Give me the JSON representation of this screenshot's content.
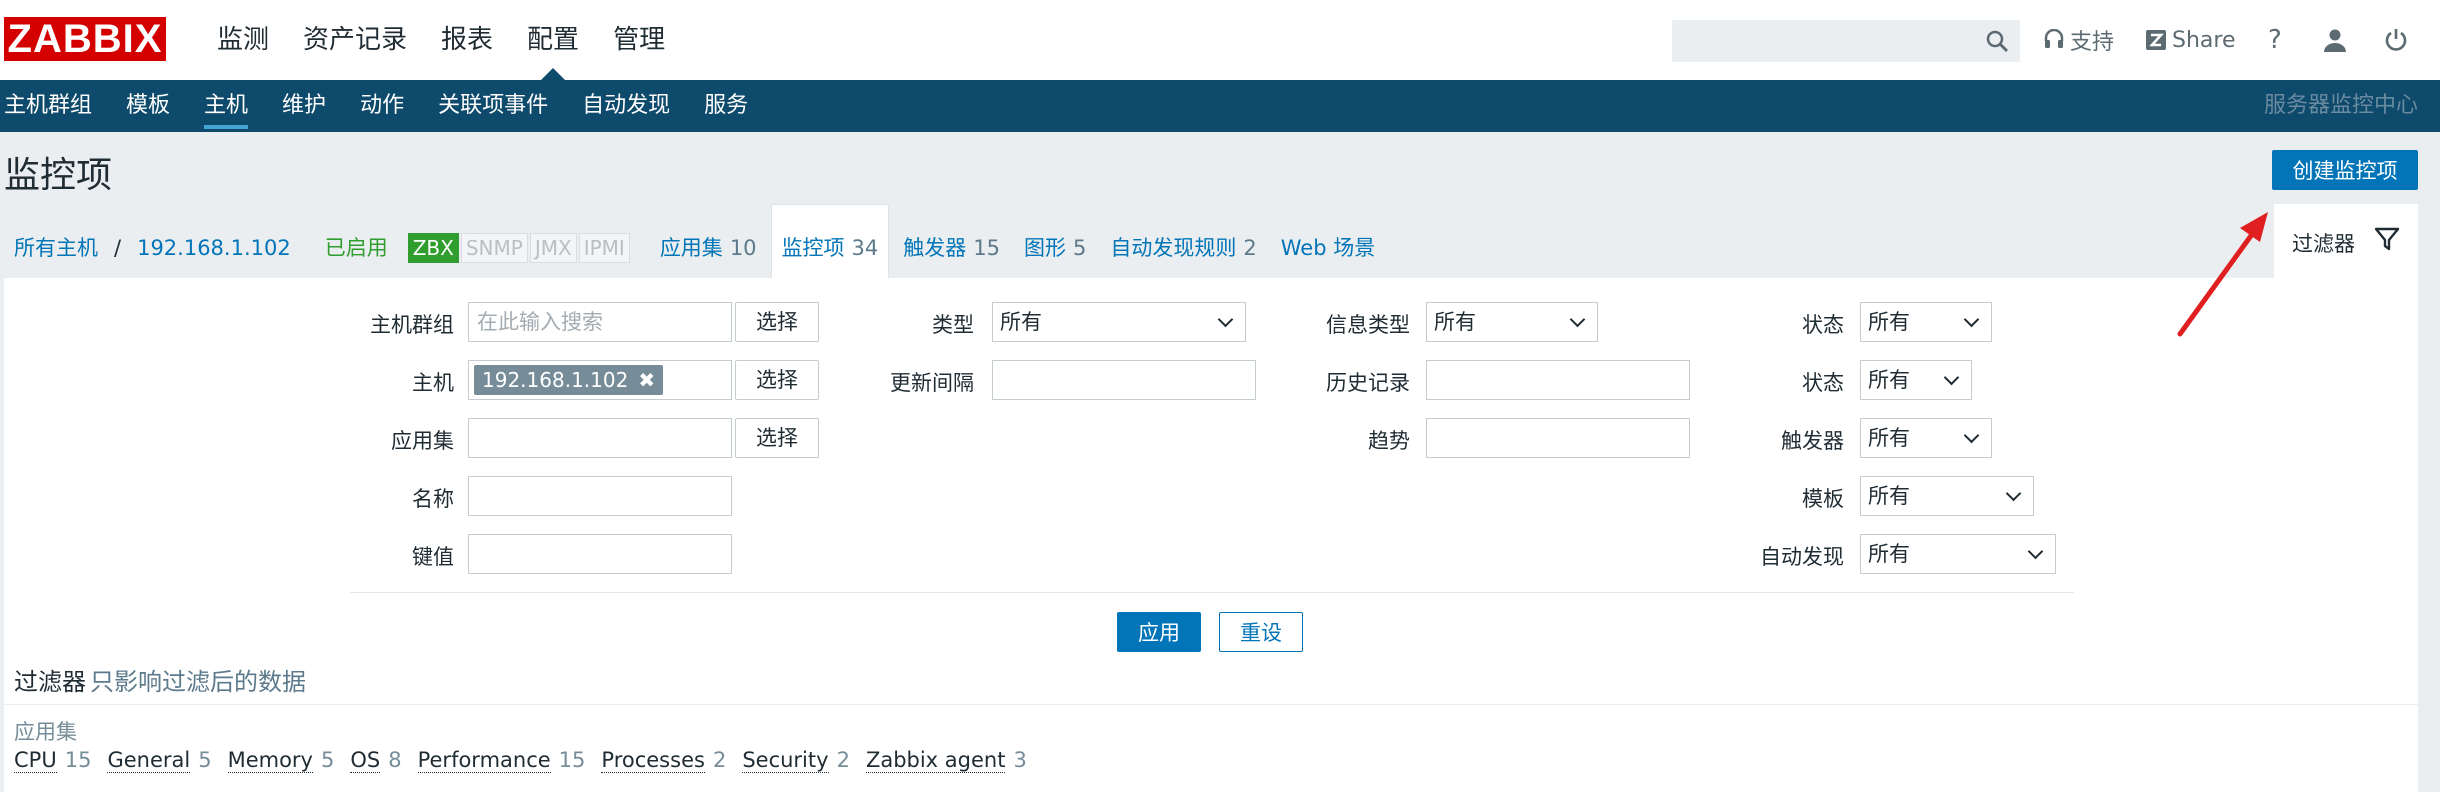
{
  "logo": "ZABBIX",
  "main_menu": [
    {
      "label": "监测"
    },
    {
      "label": "资产记录"
    },
    {
      "label": "报表"
    },
    {
      "label": "配置",
      "active": true
    },
    {
      "label": "管理"
    }
  ],
  "header_right": {
    "support_label": "支持",
    "share_label": "Share",
    "icons": [
      "search-icon",
      "headset-icon",
      "zabbix-share-icon",
      "help-icon",
      "user-icon",
      "power-icon"
    ]
  },
  "sub_menu": [
    {
      "label": "主机群组"
    },
    {
      "label": "模板"
    },
    {
      "label": "主机",
      "active": true
    },
    {
      "label": "维护"
    },
    {
      "label": "动作"
    },
    {
      "label": "关联项事件"
    },
    {
      "label": "自动发现"
    },
    {
      "label": "服务"
    }
  ],
  "server_name": "服务器监控中心",
  "page_title": "监控项",
  "create_button": "创建监控项",
  "breadcrumb": {
    "all_hosts": "所有主机",
    "separator": "/",
    "host": "192.168.1.102",
    "status": "已启用",
    "badges": [
      "ZBX",
      "SNMP",
      "JMX",
      "IPMI"
    ]
  },
  "host_tabs": [
    {
      "label": "应用集",
      "count": "10"
    },
    {
      "label": "监控项",
      "count": "34",
      "current": true
    },
    {
      "label": "触发器",
      "count": "15"
    },
    {
      "label": "图形",
      "count": "5"
    },
    {
      "label": "自动发现规则",
      "count": "2"
    },
    {
      "label": "Web 场景",
      "count": ""
    }
  ],
  "filter_tab_label": "过滤器",
  "filter": {
    "host_group": {
      "label": "主机群组",
      "placeholder": "在此输入搜索",
      "button": "选择"
    },
    "host": {
      "label": "主机",
      "tag": "192.168.1.102",
      "button": "选择"
    },
    "application": {
      "label": "应用集",
      "value": "",
      "button": "选择"
    },
    "name": {
      "label": "名称",
      "value": ""
    },
    "key": {
      "label": "键值",
      "value": ""
    },
    "type": {
      "label": "类型",
      "value": "所有"
    },
    "update_interval": {
      "label": "更新间隔",
      "value": ""
    },
    "info_type": {
      "label": "信息类型",
      "value": "所有"
    },
    "history": {
      "label": "历史记录",
      "value": ""
    },
    "trends": {
      "label": "趋势",
      "value": ""
    },
    "state": {
      "label": "状态",
      "value": "所有"
    },
    "status": {
      "label": "状态",
      "value": "所有"
    },
    "triggers": {
      "label": "触发器",
      "value": "所有"
    },
    "template": {
      "label": "模板",
      "value": "所有"
    },
    "discovery": {
      "label": "自动发现",
      "value": "所有"
    },
    "apply_button": "应用",
    "reset_button": "重设"
  },
  "subfilter": {
    "title": "过滤器",
    "hint": "只影响过滤后的数据",
    "applications_label": "应用集",
    "applications": [
      {
        "name": "CPU",
        "count": "15"
      },
      {
        "name": "General",
        "count": "5"
      },
      {
        "name": "Memory",
        "count": "5"
      },
      {
        "name": "OS",
        "count": "8"
      },
      {
        "name": "Performance",
        "count": "15"
      },
      {
        "name": "Processes",
        "count": "2"
      },
      {
        "name": "Security",
        "count": "2"
      },
      {
        "name": "Zabbix agent",
        "count": "3"
      }
    ]
  },
  "colors": {
    "brand_red": "#d40000",
    "nav_dark": "#0e4a6c",
    "primary": "#0275b8",
    "enabled_green": "#2f9e2f",
    "annotation_arrow": "#e02020"
  }
}
